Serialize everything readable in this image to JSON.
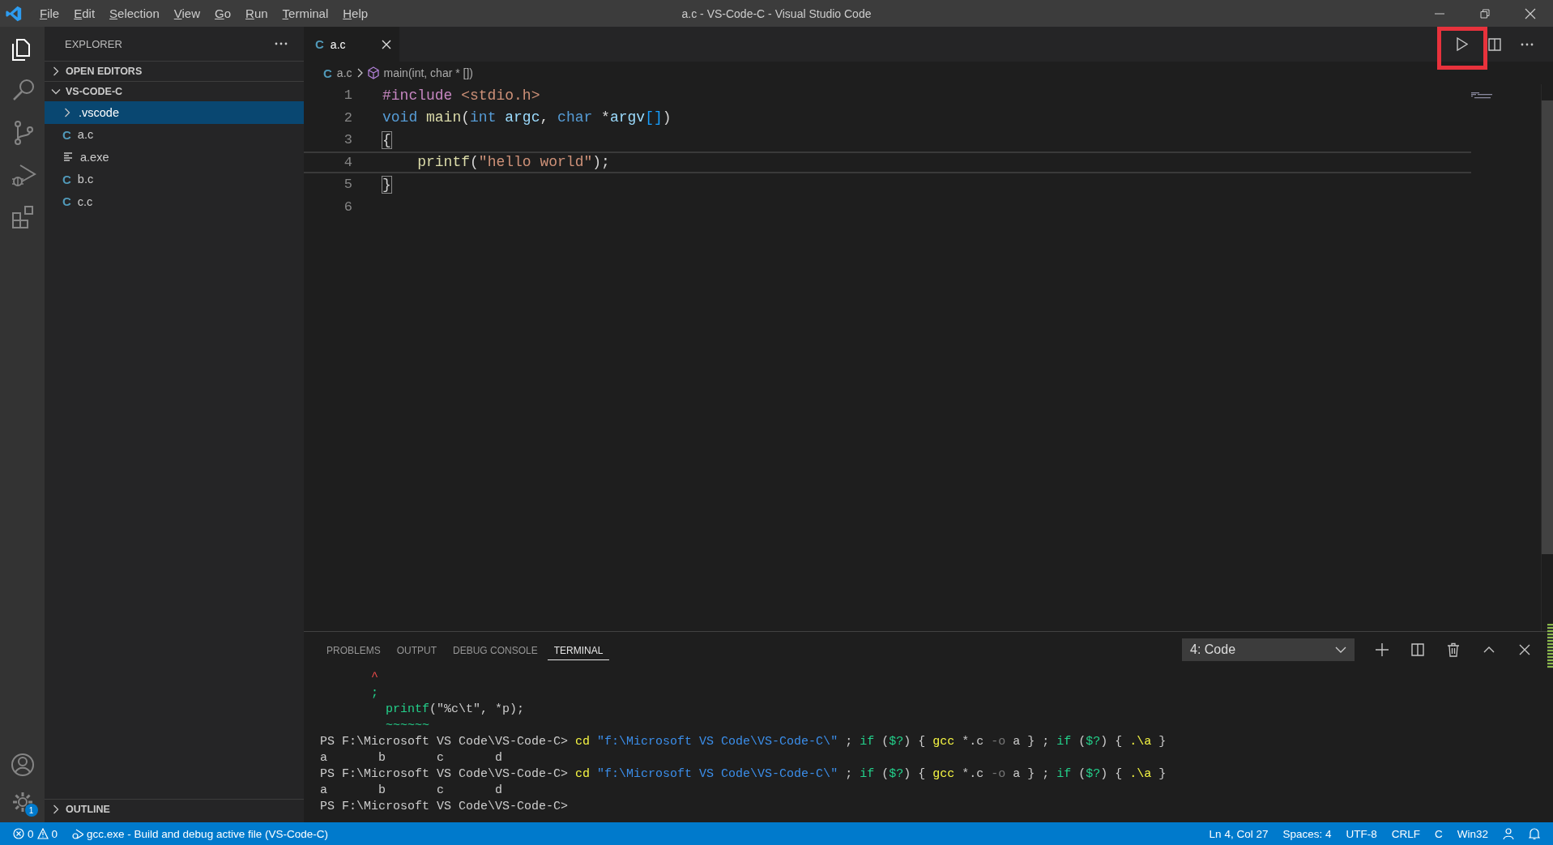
{
  "window": {
    "title": "a.c - VS-Code-C - Visual Studio Code"
  },
  "menu": [
    "File",
    "Edit",
    "Selection",
    "View",
    "Go",
    "Run",
    "Terminal",
    "Help"
  ],
  "activity_bar": {
    "items": [
      {
        "kind": "explorer",
        "selected": true
      },
      {
        "kind": "search",
        "selected": false
      },
      {
        "kind": "source-control",
        "selected": false
      },
      {
        "kind": "run-debug",
        "selected": false
      },
      {
        "kind": "extensions",
        "selected": false
      }
    ],
    "settings_badge": "1"
  },
  "sidebar": {
    "title": "EXPLORER",
    "sections": [
      {
        "title": "OPEN EDITORS",
        "expanded": false
      },
      {
        "title": "VS-CODE-C",
        "expanded": true,
        "children": [
          {
            "name": ".vscode",
            "kind": "folder",
            "expanded": false,
            "selected": true
          },
          {
            "name": "a.c",
            "kind": "c",
            "glyph": "C",
            "selected": false
          },
          {
            "name": "a.exe",
            "kind": "file",
            "selected": false
          },
          {
            "name": "b.c",
            "kind": "c",
            "glyph": "C",
            "selected": false
          },
          {
            "name": "c.c",
            "kind": "c",
            "glyph": "C",
            "selected": false
          }
        ]
      }
    ],
    "bottom_sections": [
      {
        "title": "OUTLINE",
        "expanded": false
      }
    ]
  },
  "editor": {
    "tabs": [
      {
        "label": "a.c",
        "glyph": "C",
        "selected": true
      }
    ],
    "actions": [
      {
        "kind": "run",
        "highlighted": true
      },
      {
        "kind": "split",
        "highlighted": false
      },
      {
        "kind": "more",
        "highlighted": false
      }
    ],
    "breadcrumb": [
      {
        "kind": "file",
        "glyph": "C",
        "label": "a.c"
      },
      {
        "kind": "symbol",
        "label": "main(int, char * [])"
      }
    ],
    "lines": [
      {
        "number": "1",
        "current": false,
        "tokens": [
          {
            "text": "#include ",
            "kind": "preprocessor"
          },
          {
            "text": "<stdio.h>",
            "kind": "string"
          }
        ]
      },
      {
        "number": "2",
        "current": false,
        "tokens": [
          {
            "text": "void ",
            "kind": "keyword"
          },
          {
            "text": "main",
            "kind": "function"
          },
          {
            "text": "(",
            "kind": "plain"
          },
          {
            "text": "int ",
            "kind": "keyword"
          },
          {
            "text": "argc",
            "kind": "variable"
          },
          {
            "text": ", ",
            "kind": "plain"
          },
          {
            "text": "char ",
            "kind": "keyword"
          },
          {
            "text": "*",
            "kind": "plain"
          },
          {
            "text": "argv",
            "kind": "variable"
          },
          {
            "text": "[]",
            "kind": "bracket"
          },
          {
            "text": ")",
            "kind": "plain"
          }
        ]
      },
      {
        "number": "3",
        "current": false,
        "tokens": [
          {
            "text": "{",
            "kind": "brace_match"
          }
        ]
      },
      {
        "number": "4",
        "current": true,
        "tokens": [
          {
            "text": "    printf",
            "kind": "function"
          },
          {
            "text": "(",
            "kind": "plain"
          },
          {
            "text": "\"hello world\"",
            "kind": "string"
          },
          {
            "text": ");",
            "kind": "plain"
          }
        ]
      },
      {
        "number": "5",
        "current": false,
        "tokens": [
          {
            "text": "}",
            "kind": "brace_match"
          }
        ]
      },
      {
        "number": "6",
        "current": false
      }
    ]
  },
  "panel": {
    "tabs": [
      {
        "label": "PROBLEMS",
        "selected": false
      },
      {
        "label": "OUTPUT",
        "selected": false
      },
      {
        "label": "DEBUG CONSOLE",
        "selected": false
      },
      {
        "label": "TERMINAL",
        "selected": true
      }
    ],
    "terminal_picker": "4: Code",
    "terminal_lines": [
      [
        {
          "text": "       ^",
          "kind": "red"
        }
      ],
      [
        {
          "text": "       ;",
          "kind": "green"
        }
      ],
      [
        {
          "text": "         printf",
          "kind": "green"
        },
        {
          "text": "(\"%c\\t\", *p);",
          "kind": "plain"
        }
      ],
      [
        {
          "text": "         ~~~~~~",
          "kind": "green"
        }
      ],
      [
        {
          "text": "PS F:\\Microsoft VS Code\\VS-Code-C> ",
          "kind": "plain"
        },
        {
          "text": "cd ",
          "kind": "yellow"
        },
        {
          "text": "\"f:\\Microsoft VS Code\\VS-Code-C\\\"",
          "kind": "blue"
        },
        {
          "text": " ; ",
          "kind": "plain"
        },
        {
          "text": "if",
          "kind": "green"
        },
        {
          "text": " (",
          "kind": "plain"
        },
        {
          "text": "$?",
          "kind": "green"
        },
        {
          "text": ") { ",
          "kind": "plain"
        },
        {
          "text": "gcc",
          "kind": "yellow"
        },
        {
          "text": " *.c ",
          "kind": "plain"
        },
        {
          "text": "-o",
          "kind": "dim"
        },
        {
          "text": " a } ; ",
          "kind": "plain"
        },
        {
          "text": "if",
          "kind": "green"
        },
        {
          "text": " (",
          "kind": "plain"
        },
        {
          "text": "$?",
          "kind": "green"
        },
        {
          "text": ") { ",
          "kind": "plain"
        },
        {
          "text": ".\\a",
          "kind": "yellow"
        },
        {
          "text": " }",
          "kind": "plain"
        }
      ],
      [
        {
          "text": "a       b       c       d",
          "kind": "plain"
        }
      ],
      [
        {
          "text": "PS F:\\Microsoft VS Code\\VS-Code-C> ",
          "kind": "plain"
        },
        {
          "text": "cd ",
          "kind": "yellow"
        },
        {
          "text": "\"f:\\Microsoft VS Code\\VS-Code-C\\\"",
          "kind": "blue"
        },
        {
          "text": " ; ",
          "kind": "plain"
        },
        {
          "text": "if",
          "kind": "green"
        },
        {
          "text": " (",
          "kind": "plain"
        },
        {
          "text": "$?",
          "kind": "green"
        },
        {
          "text": ") { ",
          "kind": "plain"
        },
        {
          "text": "gcc",
          "kind": "yellow"
        },
        {
          "text": " *.c ",
          "kind": "plain"
        },
        {
          "text": "-o",
          "kind": "dim"
        },
        {
          "text": " a } ; ",
          "kind": "plain"
        },
        {
          "text": "if",
          "kind": "green"
        },
        {
          "text": " (",
          "kind": "plain"
        },
        {
          "text": "$?",
          "kind": "green"
        },
        {
          "text": ") { ",
          "kind": "plain"
        },
        {
          "text": ".\\a",
          "kind": "yellow"
        },
        {
          "text": " }",
          "kind": "plain"
        }
      ],
      [
        {
          "text": "a       b       c       d",
          "kind": "plain"
        }
      ],
      [
        {
          "text": "PS F:\\Microsoft VS Code\\VS-Code-C>",
          "kind": "plain"
        }
      ]
    ]
  },
  "status_bar": {
    "errors": "0",
    "warnings": "0",
    "task": "gcc.exe - Build and debug active file (VS-Code-C)",
    "right": [
      "Ln 4, Col 27",
      "Spaces: 4",
      "UTF-8",
      "CRLF",
      "C",
      "Win32"
    ]
  }
}
